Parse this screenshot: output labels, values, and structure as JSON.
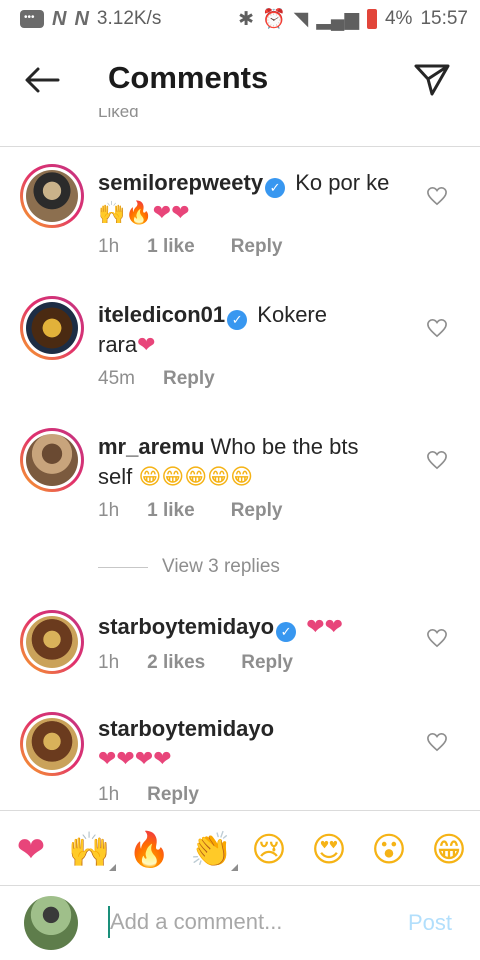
{
  "status_bar": {
    "speed": "3.12K/s",
    "battery": "4%",
    "time": "15:57",
    "carrier_icons": [
      "N",
      "N"
    ]
  },
  "header": {
    "title": "Comments",
    "back_icon": "arrow-left-icon",
    "share_icon": "paper-plane-icon"
  },
  "clipped_text": "Liked",
  "comments": [
    {
      "username": "semilorepweety",
      "verified": true,
      "text": "Ko por ke",
      "emojis": "🙌🔥",
      "hearts": "❤❤",
      "time": "1h",
      "likes": "1 like",
      "reply": "Reply"
    },
    {
      "username": "iteledicon01",
      "verified": true,
      "text": "Kokere",
      "text_line2": "rara",
      "hearts": "❤",
      "time": "45m",
      "likes": "",
      "reply": "Reply"
    },
    {
      "username": "mr_aremu",
      "verified": false,
      "text": "Who be the bts",
      "text_line2": "self",
      "emojis": "😁😁😁😁😁",
      "time": "1h",
      "likes": "1 like",
      "reply": "Reply"
    },
    {
      "username": "starboytemidayo",
      "verified": true,
      "hearts": "❤❤",
      "time": "1h",
      "likes": "2 likes",
      "reply": "Reply"
    },
    {
      "username": "starboytemidayo",
      "verified": false,
      "hearts": "❤❤❤❤",
      "time": "1h",
      "likes": "",
      "reply": "Reply"
    }
  ],
  "view_replies": "View 3 replies",
  "emoji_bar": [
    "❤",
    "🙌",
    "🔥",
    "👏",
    "😢",
    "😍",
    "😮",
    "😁"
  ],
  "composer": {
    "placeholder": "Add a comment...",
    "post_label": "Post"
  },
  "colors": {
    "heart": "#e8457a",
    "verified": "#3897f0",
    "post_disabled": "#b2dffc"
  }
}
